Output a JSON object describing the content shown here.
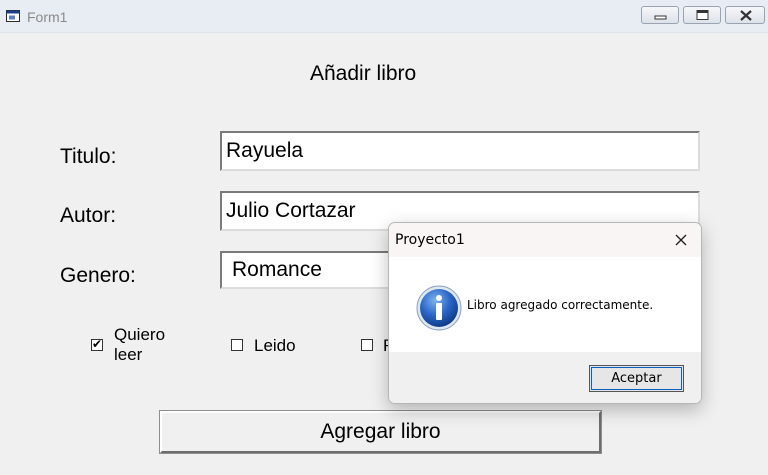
{
  "window": {
    "title": "Form1",
    "icon": "form-app-icon",
    "controls": [
      "minimize-icon",
      "maximize-icon",
      "close-icon"
    ]
  },
  "form": {
    "heading": "Añadir libro",
    "fields": {
      "titulo": {
        "label": "Titulo:",
        "value": "Rayuela"
      },
      "autor": {
        "label": "Autor:",
        "value": "Julio Cortazar"
      },
      "genero": {
        "label": "Genero:",
        "value": "Romance"
      }
    },
    "checkboxes": {
      "quiero_leer": {
        "label": "Quiero leer",
        "checked": true
      },
      "leido": {
        "label": "Leido",
        "checked": false
      },
      "third": {
        "label": "F",
        "checked": false
      }
    },
    "submit_label": "Agregar libro"
  },
  "dialog": {
    "title": "Proyecto1",
    "message": "Libro agregado correctamente.",
    "icon": "info-icon",
    "ok_label": "Aceptar"
  }
}
